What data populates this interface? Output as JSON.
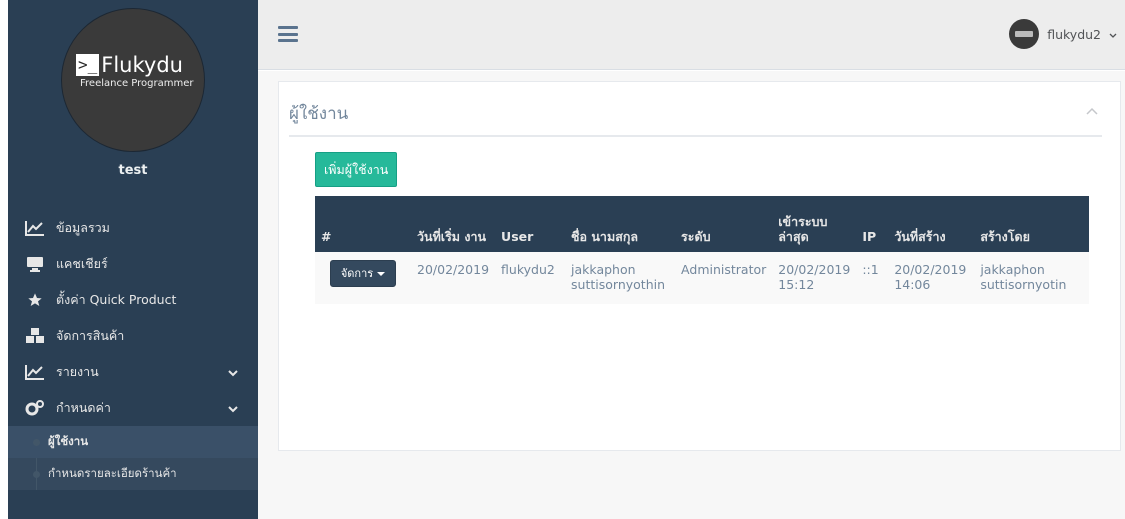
{
  "sidebar": {
    "logo_main": "Flukydu",
    "logo_prompt": ">_",
    "logo_sub": "Freelance Programmer",
    "profile_name": "test",
    "items": [
      {
        "label": "ข้อมูลรวม",
        "icon": "line-chart-icon"
      },
      {
        "label": "แคชเชียร์",
        "icon": "desktop-icon"
      },
      {
        "label": "ตั้งค่า Quick Product",
        "icon": "star-icon"
      },
      {
        "label": "จัดการสินค้า",
        "icon": "cubes-icon"
      },
      {
        "label": "รายงาน",
        "icon": "line-chart-icon"
      },
      {
        "label": "กำหนดค่า",
        "icon": "cogs-icon"
      }
    ],
    "subitems": [
      {
        "label": "ผู้ใช้งาน"
      },
      {
        "label": "กำหนดรายละเอียดร้านค้า"
      }
    ]
  },
  "topbar": {
    "username": "flukydu2"
  },
  "panel": {
    "title": "ผู้ใช้งาน",
    "add_button": "เพิ่มผู้ใช้งาน"
  },
  "table": {
    "headers": [
      "#",
      "วันที่เริ่ม งาน",
      "User",
      "ชื่อ นามสกุล",
      "ระดับ",
      "เข้าระบบ ล่าสุด",
      "IP",
      "วันที่สร้าง",
      "สร้างโดย"
    ],
    "rows": [
      {
        "action": "จัดการ",
        "start_date": "20/02/2019",
        "user": "flukydu2",
        "fullname": "jakkaphon suttisornyothin",
        "level": "Administrator",
        "last_login": "20/02/2019 15:12",
        "ip": "::1",
        "created": "20/02/2019 14:06",
        "created_by": "jakkaphon suttisornyotin"
      }
    ]
  },
  "colors": {
    "sidebar": "#2a3f54",
    "accent": "#1abb9c",
    "add_button": "#26b99a",
    "table_header": "#2a3f54"
  }
}
